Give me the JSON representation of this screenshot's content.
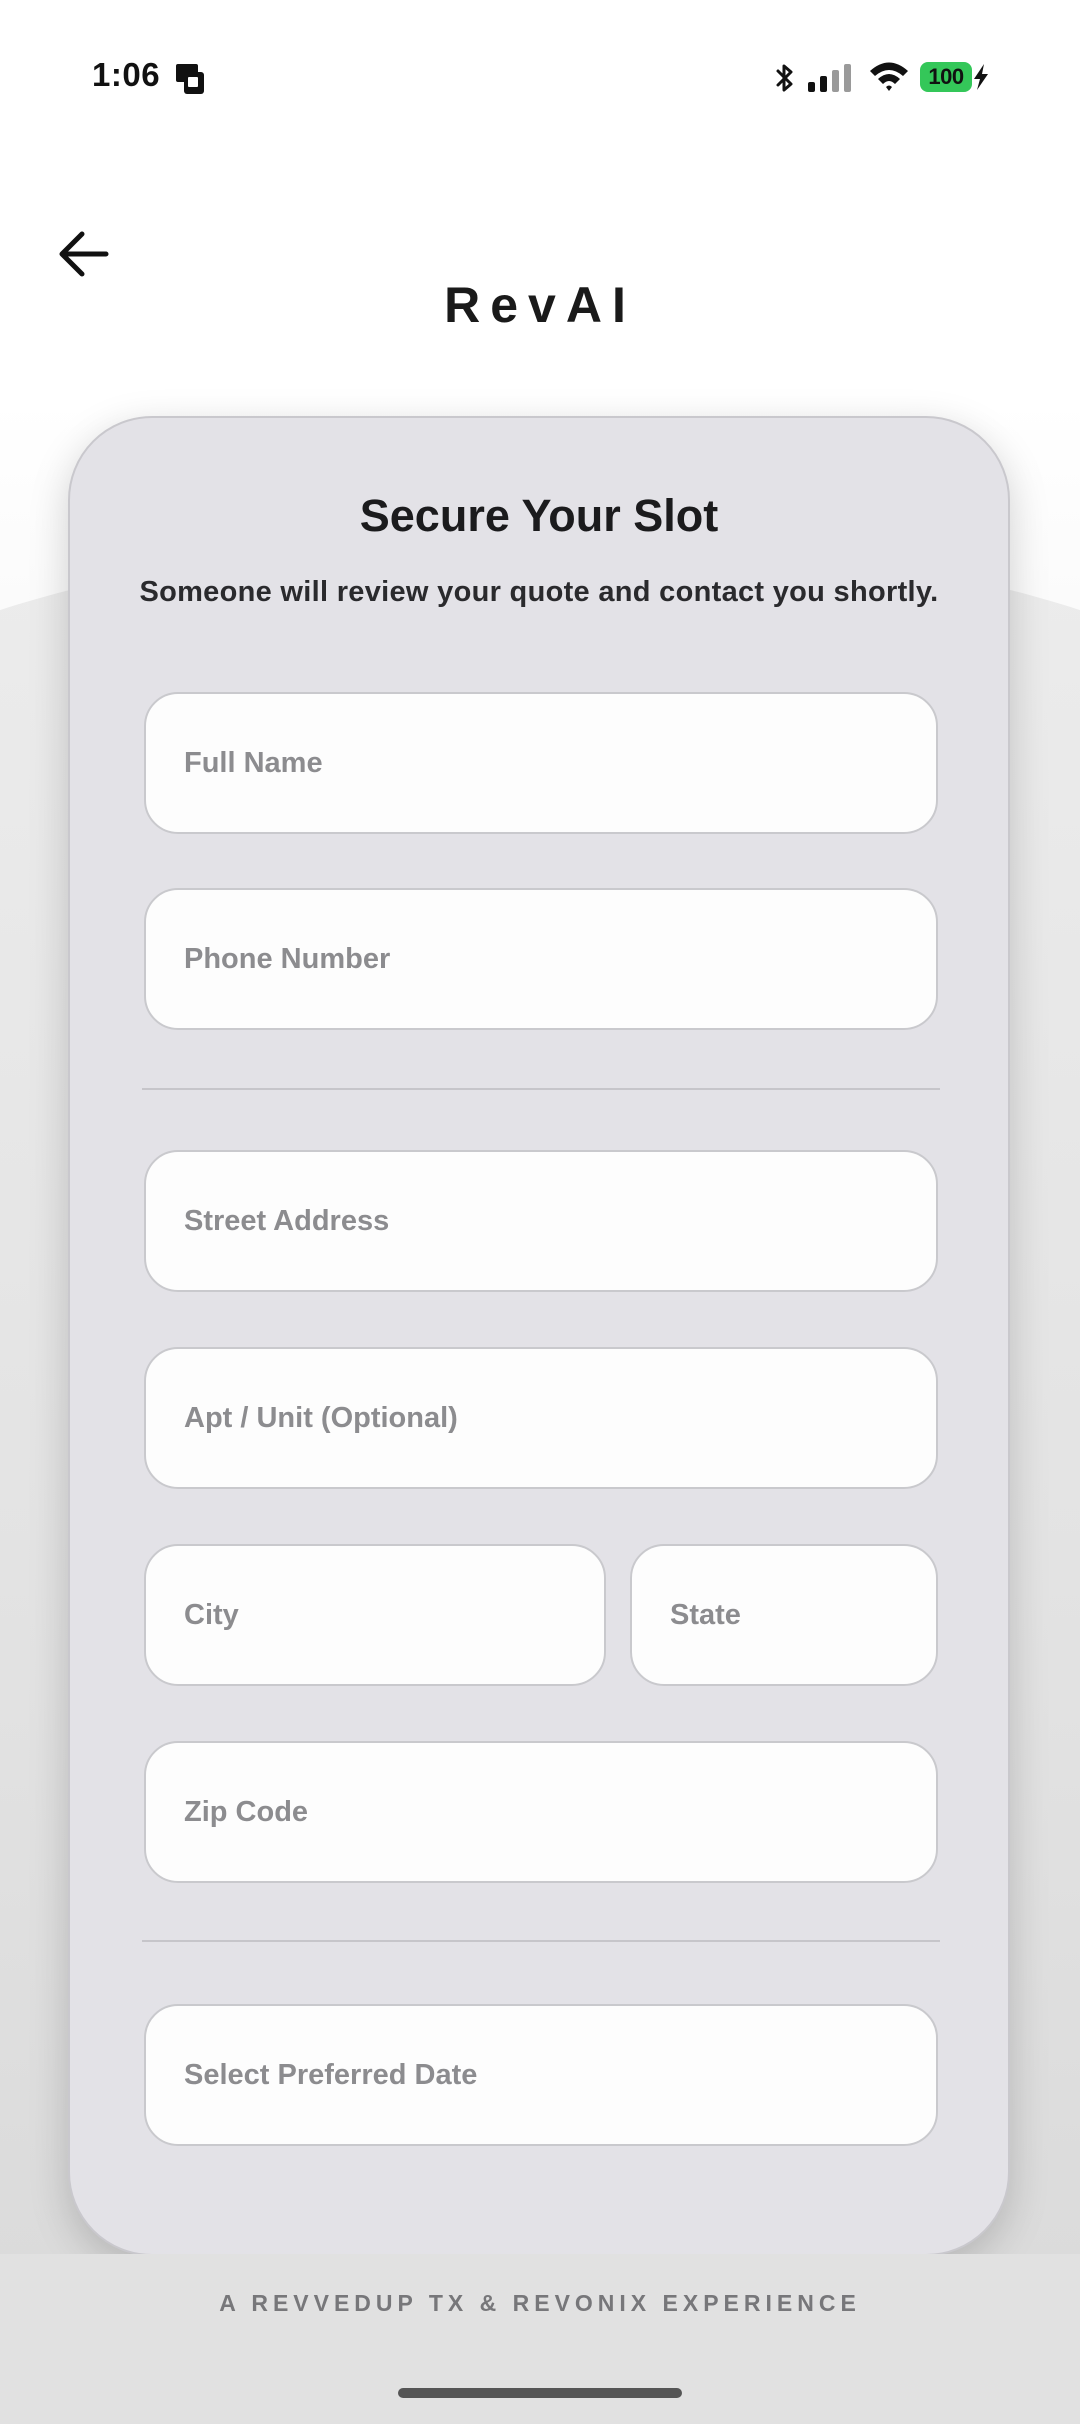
{
  "status_bar": {
    "time": "1:06",
    "battery": "100"
  },
  "header": {
    "title": "RevAI"
  },
  "form": {
    "title": "Secure Your Slot",
    "subtitle": "Someone will review your quote and contact you shortly.",
    "full_name_placeholder": "Full Name",
    "phone_placeholder": "Phone Number",
    "street_placeholder": "Street Address",
    "apt_placeholder": "Apt / Unit (Optional)",
    "city_placeholder": "City",
    "state_placeholder": "State",
    "zip_placeholder": "Zip Code",
    "date_placeholder": "Select Preferred Date"
  },
  "footer": {
    "tagline": "A REVVEDUP TX & REVONIX EXPERIENCE"
  },
  "colors": {
    "battery": "#34c759",
    "card_background": "#e3e2e7",
    "field_background": "#fdfdfd",
    "placeholder": "#8c8c8f"
  }
}
